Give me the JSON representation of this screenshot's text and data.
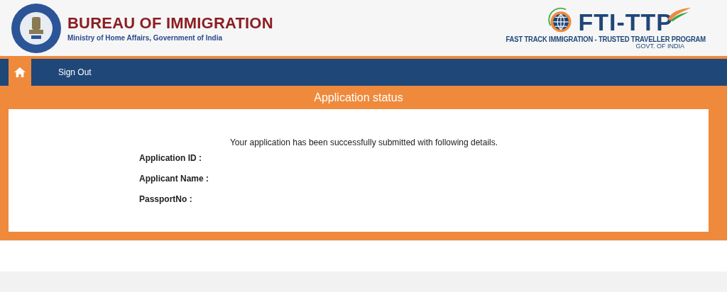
{
  "header": {
    "title": "BUREAU OF IMMIGRATION",
    "subtitle": "Ministry of Home Affairs, Government of India",
    "program": {
      "name": "FTI-TTP",
      "tagline": "FAST TRACK IMMIGRATION - TRUSTED TRAVELLER PROGRAM",
      "govt": "GOVT. OF INDIA"
    }
  },
  "nav": {
    "items": [
      {
        "kind": "home",
        "selected": true
      },
      {
        "kind": "link",
        "label": "Sign Out",
        "selected": false
      }
    ]
  },
  "panel": {
    "title": "Application status",
    "message": "Your application has been successfully submitted with following details.",
    "fields": [
      {
        "label": "Application ID :"
      },
      {
        "label": "Applicant Name :"
      },
      {
        "label": "PassportNo :"
      }
    ]
  }
}
